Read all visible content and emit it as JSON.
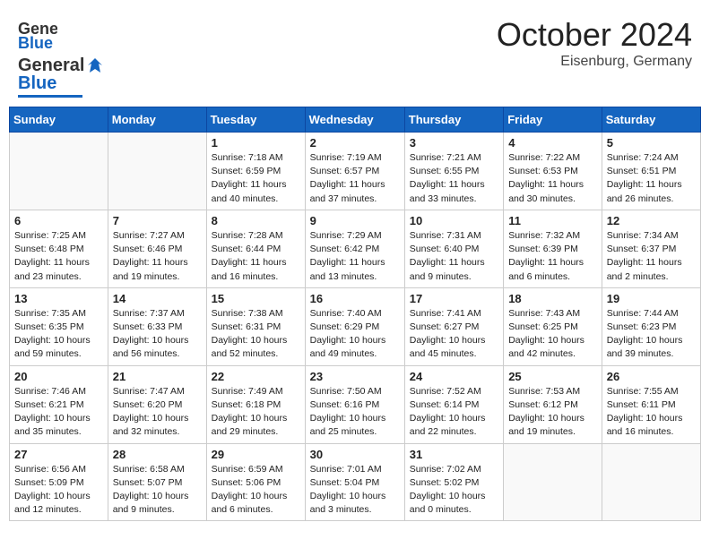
{
  "header": {
    "logo_general": "General",
    "logo_blue": "Blue",
    "month": "October 2024",
    "location": "Eisenburg, Germany"
  },
  "days_of_week": [
    "Sunday",
    "Monday",
    "Tuesday",
    "Wednesday",
    "Thursday",
    "Friday",
    "Saturday"
  ],
  "weeks": [
    [
      {
        "day": "",
        "sunrise": "",
        "sunset": "",
        "daylight": ""
      },
      {
        "day": "",
        "sunrise": "",
        "sunset": "",
        "daylight": ""
      },
      {
        "day": "1",
        "sunrise": "Sunrise: 7:18 AM",
        "sunset": "Sunset: 6:59 PM",
        "daylight": "Daylight: 11 hours and 40 minutes."
      },
      {
        "day": "2",
        "sunrise": "Sunrise: 7:19 AM",
        "sunset": "Sunset: 6:57 PM",
        "daylight": "Daylight: 11 hours and 37 minutes."
      },
      {
        "day": "3",
        "sunrise": "Sunrise: 7:21 AM",
        "sunset": "Sunset: 6:55 PM",
        "daylight": "Daylight: 11 hours and 33 minutes."
      },
      {
        "day": "4",
        "sunrise": "Sunrise: 7:22 AM",
        "sunset": "Sunset: 6:53 PM",
        "daylight": "Daylight: 11 hours and 30 minutes."
      },
      {
        "day": "5",
        "sunrise": "Sunrise: 7:24 AM",
        "sunset": "Sunset: 6:51 PM",
        "daylight": "Daylight: 11 hours and 26 minutes."
      }
    ],
    [
      {
        "day": "6",
        "sunrise": "Sunrise: 7:25 AM",
        "sunset": "Sunset: 6:48 PM",
        "daylight": "Daylight: 11 hours and 23 minutes."
      },
      {
        "day": "7",
        "sunrise": "Sunrise: 7:27 AM",
        "sunset": "Sunset: 6:46 PM",
        "daylight": "Daylight: 11 hours and 19 minutes."
      },
      {
        "day": "8",
        "sunrise": "Sunrise: 7:28 AM",
        "sunset": "Sunset: 6:44 PM",
        "daylight": "Daylight: 11 hours and 16 minutes."
      },
      {
        "day": "9",
        "sunrise": "Sunrise: 7:29 AM",
        "sunset": "Sunset: 6:42 PM",
        "daylight": "Daylight: 11 hours and 13 minutes."
      },
      {
        "day": "10",
        "sunrise": "Sunrise: 7:31 AM",
        "sunset": "Sunset: 6:40 PM",
        "daylight": "Daylight: 11 hours and 9 minutes."
      },
      {
        "day": "11",
        "sunrise": "Sunrise: 7:32 AM",
        "sunset": "Sunset: 6:39 PM",
        "daylight": "Daylight: 11 hours and 6 minutes."
      },
      {
        "day": "12",
        "sunrise": "Sunrise: 7:34 AM",
        "sunset": "Sunset: 6:37 PM",
        "daylight": "Daylight: 11 hours and 2 minutes."
      }
    ],
    [
      {
        "day": "13",
        "sunrise": "Sunrise: 7:35 AM",
        "sunset": "Sunset: 6:35 PM",
        "daylight": "Daylight: 10 hours and 59 minutes."
      },
      {
        "day": "14",
        "sunrise": "Sunrise: 7:37 AM",
        "sunset": "Sunset: 6:33 PM",
        "daylight": "Daylight: 10 hours and 56 minutes."
      },
      {
        "day": "15",
        "sunrise": "Sunrise: 7:38 AM",
        "sunset": "Sunset: 6:31 PM",
        "daylight": "Daylight: 10 hours and 52 minutes."
      },
      {
        "day": "16",
        "sunrise": "Sunrise: 7:40 AM",
        "sunset": "Sunset: 6:29 PM",
        "daylight": "Daylight: 10 hours and 49 minutes."
      },
      {
        "day": "17",
        "sunrise": "Sunrise: 7:41 AM",
        "sunset": "Sunset: 6:27 PM",
        "daylight": "Daylight: 10 hours and 45 minutes."
      },
      {
        "day": "18",
        "sunrise": "Sunrise: 7:43 AM",
        "sunset": "Sunset: 6:25 PM",
        "daylight": "Daylight: 10 hours and 42 minutes."
      },
      {
        "day": "19",
        "sunrise": "Sunrise: 7:44 AM",
        "sunset": "Sunset: 6:23 PM",
        "daylight": "Daylight: 10 hours and 39 minutes."
      }
    ],
    [
      {
        "day": "20",
        "sunrise": "Sunrise: 7:46 AM",
        "sunset": "Sunset: 6:21 PM",
        "daylight": "Daylight: 10 hours and 35 minutes."
      },
      {
        "day": "21",
        "sunrise": "Sunrise: 7:47 AM",
        "sunset": "Sunset: 6:20 PM",
        "daylight": "Daylight: 10 hours and 32 minutes."
      },
      {
        "day": "22",
        "sunrise": "Sunrise: 7:49 AM",
        "sunset": "Sunset: 6:18 PM",
        "daylight": "Daylight: 10 hours and 29 minutes."
      },
      {
        "day": "23",
        "sunrise": "Sunrise: 7:50 AM",
        "sunset": "Sunset: 6:16 PM",
        "daylight": "Daylight: 10 hours and 25 minutes."
      },
      {
        "day": "24",
        "sunrise": "Sunrise: 7:52 AM",
        "sunset": "Sunset: 6:14 PM",
        "daylight": "Daylight: 10 hours and 22 minutes."
      },
      {
        "day": "25",
        "sunrise": "Sunrise: 7:53 AM",
        "sunset": "Sunset: 6:12 PM",
        "daylight": "Daylight: 10 hours and 19 minutes."
      },
      {
        "day": "26",
        "sunrise": "Sunrise: 7:55 AM",
        "sunset": "Sunset: 6:11 PM",
        "daylight": "Daylight: 10 hours and 16 minutes."
      }
    ],
    [
      {
        "day": "27",
        "sunrise": "Sunrise: 6:56 AM",
        "sunset": "Sunset: 5:09 PM",
        "daylight": "Daylight: 10 hours and 12 minutes."
      },
      {
        "day": "28",
        "sunrise": "Sunrise: 6:58 AM",
        "sunset": "Sunset: 5:07 PM",
        "daylight": "Daylight: 10 hours and 9 minutes."
      },
      {
        "day": "29",
        "sunrise": "Sunrise: 6:59 AM",
        "sunset": "Sunset: 5:06 PM",
        "daylight": "Daylight: 10 hours and 6 minutes."
      },
      {
        "day": "30",
        "sunrise": "Sunrise: 7:01 AM",
        "sunset": "Sunset: 5:04 PM",
        "daylight": "Daylight: 10 hours and 3 minutes."
      },
      {
        "day": "31",
        "sunrise": "Sunrise: 7:02 AM",
        "sunset": "Sunset: 5:02 PM",
        "daylight": "Daylight: 10 hours and 0 minutes."
      },
      {
        "day": "",
        "sunrise": "",
        "sunset": "",
        "daylight": ""
      },
      {
        "day": "",
        "sunrise": "",
        "sunset": "",
        "daylight": ""
      }
    ]
  ]
}
